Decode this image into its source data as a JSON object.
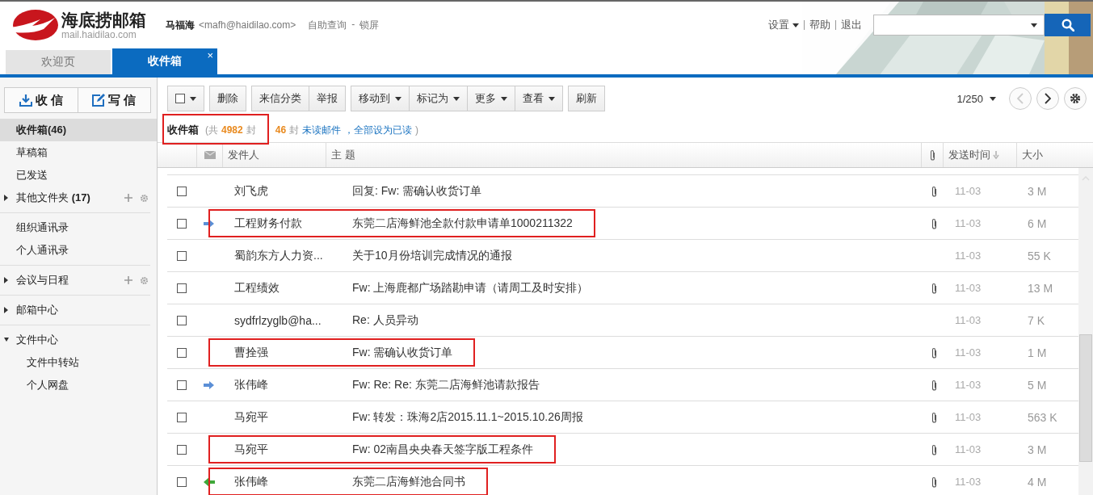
{
  "app": {
    "logo_title": "海底捞邮箱",
    "logo_subtitle": "mail.haidilao.com"
  },
  "user": {
    "name": "马福海",
    "email": "<mafh@haidilao.com>",
    "links": [
      "自助查询",
      "-",
      "锁屏"
    ]
  },
  "top_menu": [
    {
      "label": "设置",
      "dropdown": true
    },
    {
      "label": "帮助",
      "dropdown": false
    },
    {
      "label": "退出",
      "dropdown": false
    }
  ],
  "tabs": [
    {
      "label": "欢迎页",
      "selected": false
    },
    {
      "label": "收件箱",
      "selected": true,
      "close": "×"
    }
  ],
  "sidebar": {
    "actions": [
      {
        "kind": "receive",
        "label": "收 信"
      },
      {
        "kind": "compose",
        "label": "写 信"
      }
    ],
    "sections": [
      [
        {
          "label": "收件箱(46)",
          "selected": true
        },
        {
          "label": "草稿箱",
          "selected": false
        },
        {
          "label": "已发送",
          "selected": false
        },
        {
          "label": "其他文件夹 **(17)**",
          "selected": false,
          "expanded": false,
          "tools": true
        }
      ],
      [
        {
          "label": "组织通讯录",
          "selected": false
        },
        {
          "label": "个人通讯录",
          "selected": false
        }
      ],
      [
        {
          "label": "会议与日程",
          "selected": false,
          "expanded": false,
          "tools": true
        }
      ],
      [
        {
          "label": "邮箱中心",
          "selected": false,
          "expanded": false
        }
      ],
      [
        {
          "label": "文件中心",
          "selected": false,
          "expanded": true,
          "children": [
            {
              "label": "文件中转站",
              "selected": false
            },
            {
              "label": "个人网盘",
              "selected": false
            }
          ]
        }
      ]
    ]
  },
  "toolbar": {
    "groups": [
      [
        {
          "kind": "select",
          "checked": false
        }
      ],
      [
        {
          "kind": "button",
          "label": "删除",
          "dropdown": false
        }
      ],
      [
        {
          "kind": "button",
          "label": "来信分类",
          "dropdown": false
        },
        {
          "kind": "button",
          "label": "举报",
          "dropdown": false
        }
      ],
      [
        {
          "kind": "button",
          "label": "移动到",
          "dropdown": true
        },
        {
          "kind": "button",
          "label": "标记为",
          "dropdown": true
        },
        {
          "kind": "button",
          "label": "更多",
          "dropdown": true
        },
        {
          "kind": "button",
          "label": "查看",
          "dropdown": true
        }
      ],
      [
        {
          "kind": "button",
          "label": "刷新",
          "dropdown": false
        }
      ]
    ],
    "pager": {
      "label": "1/250",
      "prev_disabled": true,
      "next_disabled": false
    }
  },
  "status": {
    "title": "收件箱",
    "highlighted": true,
    "parts": [
      {
        "kind": "plain",
        "text": "(共"
      },
      {
        "kind": "count",
        "text": "4982"
      },
      {
        "kind": "plain",
        "text": "封"
      }
    ],
    "unread_parts": [
      {
        "kind": "count",
        "text": "46"
      },
      {
        "kind": "plain",
        "text": "封"
      },
      {
        "kind": "link",
        "text": "未读邮件"
      },
      {
        "kind": "link",
        "text": "，全部设为已读"
      },
      {
        "kind": "plain",
        "text": ")"
      }
    ]
  },
  "table": {
    "columns": [
      "发件人",
      "主 题",
      "发送时间",
      "大小"
    ],
    "rows": [
      {
        "checked": false,
        "kind": "plain",
        "sender": "刘飞虎",
        "subject": "回复: Fw: 需确认收货订单",
        "attachment": true,
        "date": "11-03",
        "size": "3 M",
        "highlighted": false
      },
      {
        "checked": false,
        "kind": "forwarded",
        "sender": "工程财务付款",
        "subject": "东莞二店海鲜池全款付款申请单1000211322",
        "attachment": true,
        "date": "11-03",
        "size": "6 M",
        "highlighted": true
      },
      {
        "checked": false,
        "kind": "plain",
        "sender": "蜀韵东方人力资...",
        "subject": "关于10月份培训完成情况的通报",
        "attachment": false,
        "date": "11-03",
        "size": "55 K",
        "highlighted": false
      },
      {
        "checked": false,
        "kind": "plain",
        "sender": "工程绩效",
        "subject": "Fw: 上海鹿都广场踏勘申请（请周工及时安排）",
        "attachment": true,
        "date": "11-03",
        "size": "13 M",
        "highlighted": false
      },
      {
        "checked": false,
        "kind": "plain",
        "sender": "sydfrlzyglb@ha...",
        "subject": "Re: 人员异动",
        "attachment": false,
        "date": "11-03",
        "size": "7 K",
        "highlighted": false
      },
      {
        "checked": false,
        "kind": "plain",
        "sender": "曹拴强",
        "subject": "Fw: 需确认收货订单",
        "attachment": true,
        "date": "11-03",
        "size": "1 M",
        "highlighted": true
      },
      {
        "checked": false,
        "kind": "forwarded",
        "sender": "张伟峰",
        "subject": "Fw: Re: Re: 东莞二店海鲜池请款报告",
        "attachment": true,
        "date": "11-03",
        "size": "5 M",
        "highlighted": false
      },
      {
        "checked": false,
        "kind": "plain",
        "sender": "马宛平",
        "subject": "Fw: 转发：珠海2店2015.11.1~2015.10.26周报",
        "attachment": true,
        "date": "11-03",
        "size": "563 K",
        "highlighted": false
      },
      {
        "checked": false,
        "kind": "plain",
        "sender": "马宛平",
        "subject": "Fw: 02南昌央央春天签字版工程条件",
        "attachment": true,
        "date": "11-03",
        "size": "3 M",
        "highlighted": true
      },
      {
        "checked": false,
        "kind": "replied",
        "sender": "张伟峰",
        "subject": "东莞二店海鲜池合同书",
        "attachment": true,
        "date": "11-03",
        "size": "4 M",
        "highlighted": true
      }
    ]
  }
}
